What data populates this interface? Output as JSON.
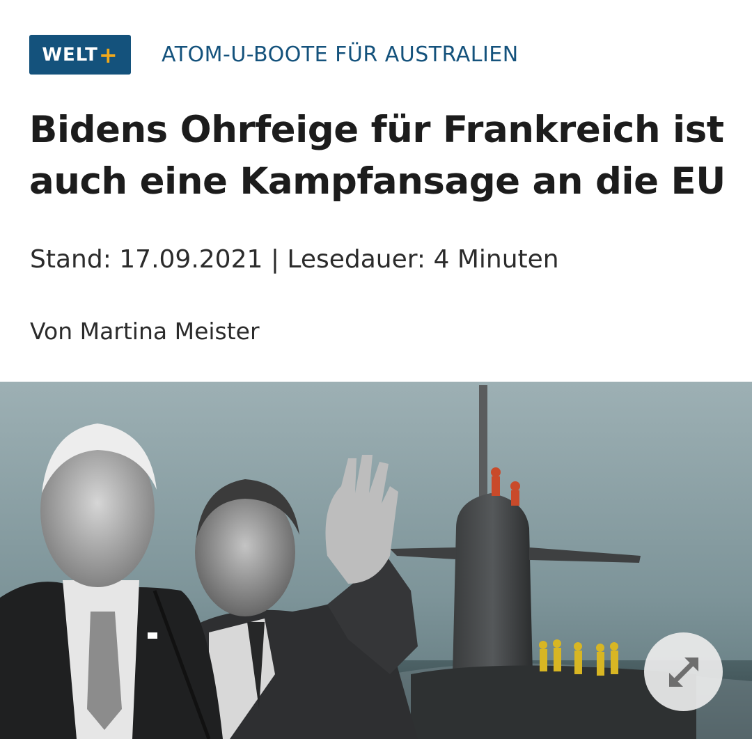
{
  "brand": {
    "logo_text": "WELT",
    "logo_plus": "+",
    "color_primary": "#14527c",
    "color_accent": "#f2a91b"
  },
  "article": {
    "kicker": "ATOM-U-BOOTE FÜR AUSTRALIEN",
    "headline": "Bidens Ohrfeige für Frankreich ist auch eine Kampfansage an die EU",
    "meta": "Stand: 17.09.2021 | Lesedauer: 4 Minuten",
    "author": "Von Martina Meister"
  },
  "hero_image": {
    "expand_icon": "expand-diagonal-arrows-icon"
  }
}
